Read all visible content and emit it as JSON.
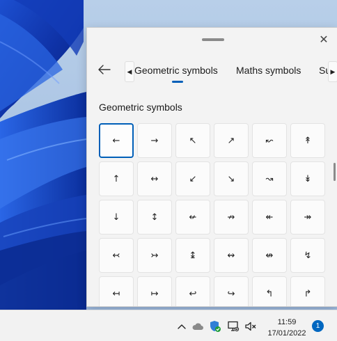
{
  "panel": {
    "close_glyph": "✕",
    "back_glyph": "←",
    "tabs": [
      {
        "label": "Geometric symbols",
        "active": true
      },
      {
        "label": "Maths symbols",
        "active": false
      },
      {
        "label": "Su",
        "active": false
      }
    ],
    "tab_scroll_left": "◀",
    "tab_scroll_right": "▶",
    "section_title": "Geometric symbols",
    "symbols": [
      "←",
      "→",
      "↖",
      "↗",
      "↜",
      "↟",
      "↑",
      "↔",
      "↙",
      "↘",
      "↝",
      "↡",
      "↓",
      "↕",
      "↚",
      "↛",
      "↞",
      "↠",
      "↢",
      "↣",
      "↨",
      "↭",
      "↮",
      "↯",
      "↤",
      "↦",
      "↩",
      "↪",
      "↰",
      "↱"
    ],
    "selected_index": 0
  },
  "taskbar": {
    "time": "11:59",
    "date": "17/01/2022",
    "notification_count": "1",
    "icons": [
      "chevron-up-icon",
      "cloud-icon",
      "defender-icon",
      "network-icon",
      "speaker-muted-icon"
    ]
  },
  "colors": {
    "accent": "#005fb8",
    "panel_bg": "#f3f3f3",
    "badge": "#0067c0"
  }
}
